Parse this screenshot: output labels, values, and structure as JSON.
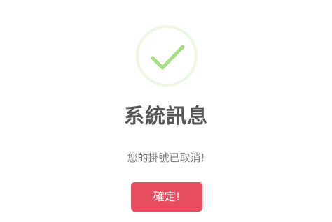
{
  "dialog": {
    "icon": "check-icon",
    "title": "系統訊息",
    "message": "您的掛號已取消!",
    "confirm_label": "確定!"
  },
  "colors": {
    "check_stroke": "#a5dc86",
    "check_ring": "#eaf7e1",
    "title": "#555555",
    "message": "#7b7b7b",
    "button_bg": "#e84c5f",
    "button_text": "#ffffff"
  }
}
